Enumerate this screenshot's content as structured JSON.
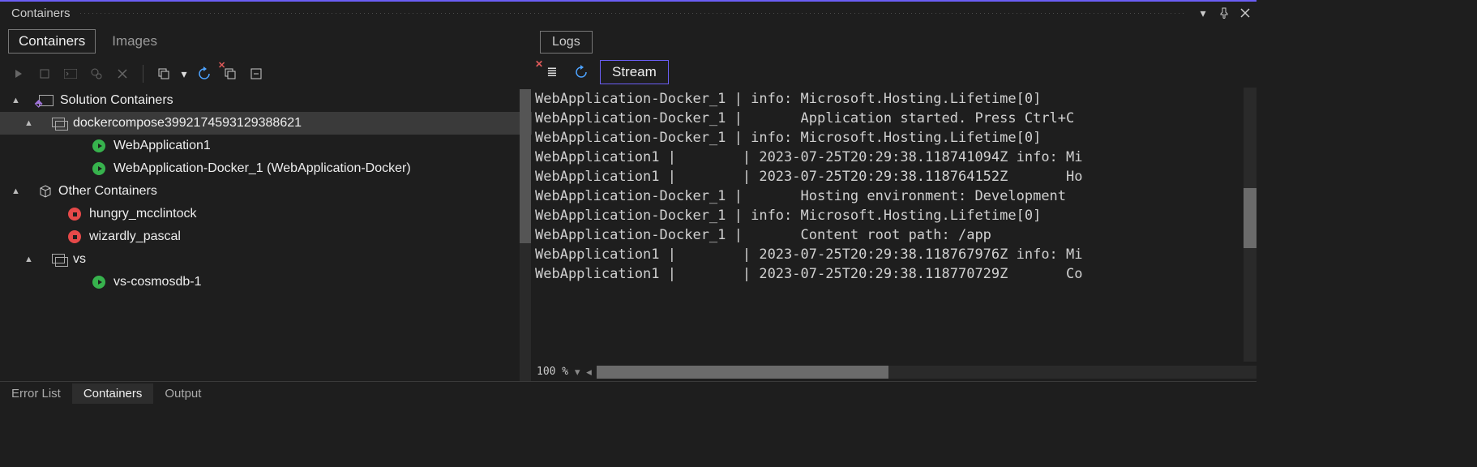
{
  "window": {
    "title": "Containers"
  },
  "leftTabs": [
    "Containers",
    "Images"
  ],
  "leftActiveTab": 0,
  "tree": {
    "solutionLabel": "Solution Containers",
    "compose": {
      "label": "dockercompose3992174593129388621",
      "children": [
        {
          "status": "run",
          "label": "WebApplication1"
        },
        {
          "status": "run",
          "label": "WebApplication-Docker_1 (WebApplication-Docker)"
        }
      ]
    },
    "otherLabel": "Other Containers",
    "otherChildren": [
      {
        "status": "stop",
        "label": "hungry_mcclintock"
      },
      {
        "status": "stop",
        "label": "wizardly_pascal"
      }
    ],
    "vs": {
      "label": "vs",
      "children": [
        {
          "status": "run",
          "label": "vs-cosmosdb-1"
        }
      ]
    }
  },
  "rightTab": "Logs",
  "streamLabel": "Stream",
  "zoom": "100 %",
  "logs": [
    "WebApplication-Docker_1 | info: Microsoft.Hosting.Lifetime[0]",
    "WebApplication-Docker_1 |       Application started. Press Ctrl+C",
    "WebApplication-Docker_1 | info: Microsoft.Hosting.Lifetime[0]",
    "WebApplication1 |        | 2023-07-25T20:29:38.118741094Z info: Mi",
    "WebApplication1 |        | 2023-07-25T20:29:38.118764152Z       Ho",
    "WebApplication-Docker_1 |       Hosting environment: Development",
    "WebApplication-Docker_1 | info: Microsoft.Hosting.Lifetime[0]",
    "WebApplication-Docker_1 |       Content root path: /app",
    "WebApplication1 |        | 2023-07-25T20:29:38.118767976Z info: Mi",
    "WebApplication1 |        | 2023-07-25T20:29:38.118770729Z       Co"
  ],
  "footerTabs": [
    "Error List",
    "Containers",
    "Output"
  ],
  "footerActive": 1
}
